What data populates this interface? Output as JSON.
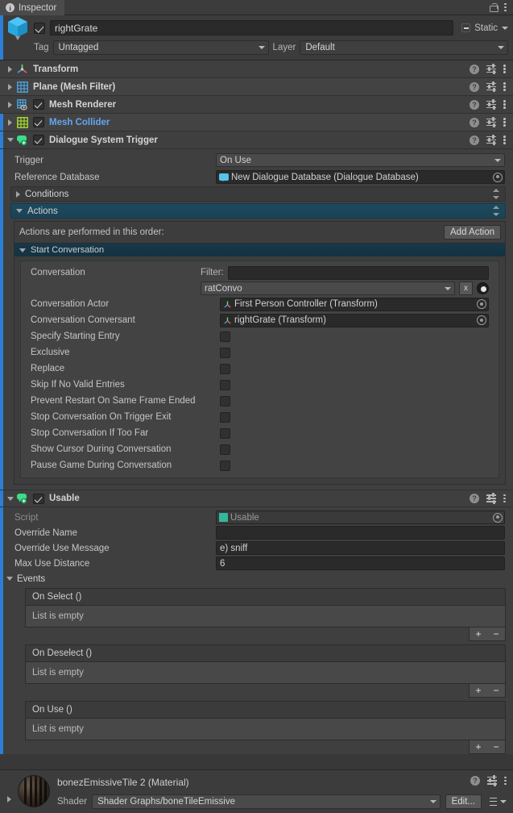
{
  "window": {
    "tab_label": "Inspector",
    "tab_icon": "info-icon",
    "lock_icon": "lock-open-icon",
    "menu_icon": "kebab-menu-icon"
  },
  "game_object": {
    "enabled": true,
    "name": "rightGrate",
    "static_label": "Static",
    "tag_label": "Tag",
    "tag_value": "Untagged",
    "layer_label": "Layer",
    "layer_value": "Default"
  },
  "components": [
    {
      "name": "Transform",
      "icon": "transform-axis-icon",
      "expanded": false,
      "has_checkbox": false,
      "checked": false,
      "selected": false,
      "title_color": "#d4d4d4"
    },
    {
      "name": "Plane (Mesh Filter)",
      "icon": "mesh-filter-grid-icon",
      "expanded": false,
      "has_checkbox": false,
      "checked": false,
      "selected": false,
      "title_color": "#d4d4d4"
    },
    {
      "name": "Mesh Renderer",
      "icon": "mesh-renderer-icon",
      "expanded": false,
      "has_checkbox": true,
      "checked": true,
      "selected": false,
      "title_color": "#d4d4d4"
    },
    {
      "name": "Mesh Collider",
      "icon": "mesh-collider-grid-icon",
      "expanded": false,
      "has_checkbox": true,
      "checked": true,
      "selected": true,
      "title_color": "#63a6f0"
    },
    {
      "name": "Dialogue System Trigger",
      "icon": "dialogue-bubble-icon",
      "expanded": true,
      "has_checkbox": true,
      "checked": true,
      "selected": true,
      "title_color": "#d4d4d4"
    }
  ],
  "dialogue_trigger": {
    "trigger_label": "Trigger",
    "trigger_value": "On Use",
    "reference_db_label": "Reference Database",
    "reference_db_value": "New Dialogue Database (Dialogue Database)",
    "conditions_label": "Conditions",
    "actions_label": "Actions",
    "actions_note": "Actions are performed in this order:",
    "add_action_label": "Add Action",
    "start_conversation_label": "Start Conversation",
    "conversation_label": "Conversation",
    "filter_label": "Filter:",
    "filter_value": "",
    "conversation_value": "ratConvo",
    "clear_button_label": "x",
    "conversation_actor_label": "Conversation Actor",
    "conversation_actor_value": "First Person Controller (Transform)",
    "conversation_conversant_label": "Conversation Conversant",
    "conversation_conversant_value": "rightGrate (Transform)",
    "checkboxes": [
      {
        "label": "Specify Starting Entry",
        "checked": false
      },
      {
        "label": "Exclusive",
        "checked": false
      },
      {
        "label": "Replace",
        "checked": false
      },
      {
        "label": "Skip If No Valid Entries",
        "checked": false
      },
      {
        "label": "Prevent Restart On Same Frame Ended",
        "checked": false
      },
      {
        "label": "Stop Conversation On Trigger Exit",
        "checked": false
      },
      {
        "label": "Stop Conversation If Too Far",
        "checked": false
      },
      {
        "label": "Show Cursor During Conversation",
        "checked": false
      },
      {
        "label": "Pause Game During Conversation",
        "checked": false
      }
    ]
  },
  "usable": {
    "title": "Usable",
    "enabled": true,
    "script_label": "Script",
    "script_value": "Usable",
    "override_name_label": "Override Name",
    "override_name_value": "",
    "override_use_message_label": "Override Use Message",
    "override_use_message_value": "e) sniff",
    "max_use_distance_label": "Max Use Distance",
    "max_use_distance_value": "6",
    "events_label": "Events",
    "events": [
      {
        "header": "On Select ()",
        "body": "List is empty",
        "add_label": "+",
        "remove_label": "−"
      },
      {
        "header": "On Deselect ()",
        "body": "List is empty",
        "add_label": "+",
        "remove_label": "−"
      },
      {
        "header": "On Use ()",
        "body": "List is empty",
        "add_label": "+",
        "remove_label": "−"
      }
    ]
  },
  "material": {
    "name": "bonezEmissiveTile 2 (Material)",
    "shader_label": "Shader",
    "shader_value": "Shader Graphs/boneTileEmissive",
    "edit_label": "Edit...",
    "preview_icon": "material-sphere-preview"
  }
}
